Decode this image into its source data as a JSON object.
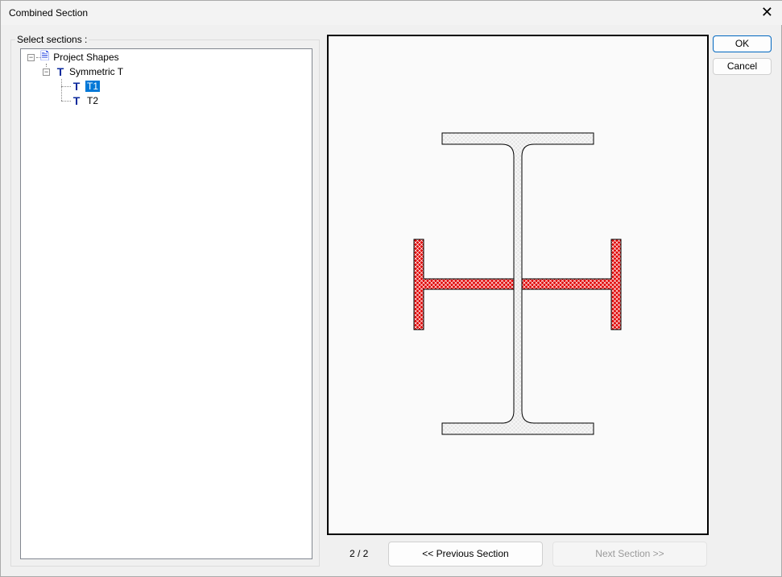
{
  "window": {
    "title": "Combined Section"
  },
  "tree": {
    "label": "Select sections :",
    "root": "Project Shapes",
    "group": "Symmetric T",
    "items": [
      "T1",
      "T2"
    ],
    "selected": "T1"
  },
  "buttons": {
    "ok": "OK",
    "cancel": "Cancel",
    "previous": "<< Previous Section",
    "next": "Next Section >>"
  },
  "pager": {
    "text": "2 / 2"
  },
  "colors": {
    "accent": "#0078d7",
    "combined_shape": "#e00000",
    "base_shape": "#e0e0e0"
  }
}
